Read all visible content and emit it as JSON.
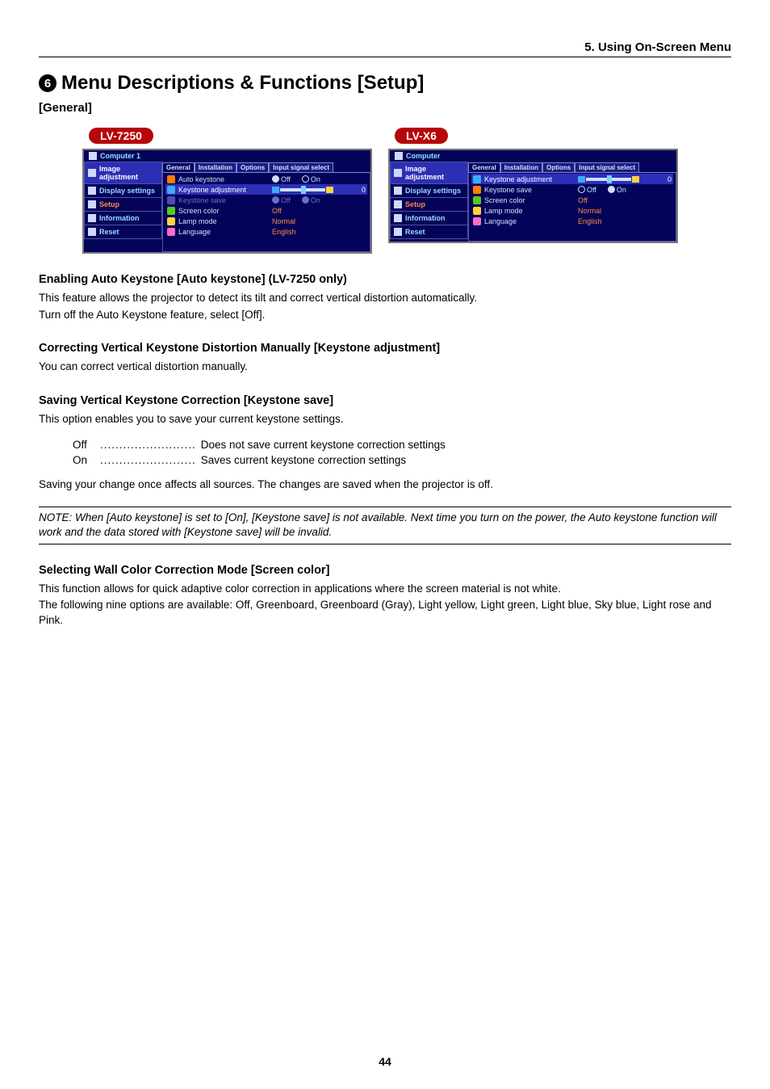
{
  "header": "5. Using On-Screen Menu",
  "bullet_number": "6",
  "main_title": "Menu Descriptions & Functions [Setup]",
  "subsection": "[General]",
  "models": {
    "left": "LV-7250",
    "right": "LV-X6"
  },
  "osd_left": {
    "top": "Computer 1",
    "side": [
      "Image adjustment",
      "Display settings",
      "Setup",
      "Information",
      "Reset"
    ],
    "tabs": [
      "General",
      "Installation",
      "Options",
      "Input signal select"
    ],
    "rows": {
      "auto_keystone": {
        "label": "Auto keystone",
        "off": "Off",
        "on": "On"
      },
      "keystone_adj": {
        "label": "Keystone adjustment",
        "val": "0"
      },
      "keystone_save": {
        "label": "Keystone save",
        "off": "Off",
        "on": "On"
      },
      "screen_color": {
        "label": "Screen color",
        "val": "Off"
      },
      "lamp_mode": {
        "label": "Lamp mode",
        "val": "Normal"
      },
      "language": {
        "label": "Language",
        "val": "English"
      }
    }
  },
  "osd_right": {
    "top": "Computer",
    "side": [
      "Image adjustment",
      "Display settings",
      "Setup",
      "Information",
      "Reset"
    ],
    "tabs": [
      "General",
      "Installation",
      "Options",
      "Input signal select"
    ],
    "rows": {
      "keystone_adj": {
        "label": "Keystone adjustment",
        "val": "0"
      },
      "keystone_save": {
        "label": "Keystone save",
        "off": "Off",
        "on": "On"
      },
      "screen_color": {
        "label": "Screen color",
        "val": "Off"
      },
      "lamp_mode": {
        "label": "Lamp mode",
        "val": "Normal"
      },
      "language": {
        "label": "Language",
        "val": "English"
      }
    }
  },
  "sections": {
    "s1": {
      "h": "Enabling Auto Keystone [Auto keystone] (LV-7250 only)",
      "p1": "This feature allows the projector to detect its tilt and correct vertical distortion automatically.",
      "p2": "Turn off the Auto Keystone feature, select [Off]."
    },
    "s2": {
      "h": "Correcting Vertical Keystone Distortion Manually [Keystone adjustment]",
      "p1": "You can correct vertical distortion manually."
    },
    "s3": {
      "h": "Saving Vertical Keystone Correction [Keystone save]",
      "p1": "This option enables you to save your current keystone settings.",
      "off": {
        "k": "Off",
        "dots": ".........................",
        "v": "Does not save current keystone correction settings"
      },
      "on": {
        "k": "On",
        "dots": ".........................",
        "v": "Saves current keystone correction settings"
      },
      "p2": "Saving your change once affects all sources. The changes are saved when the projector is off.",
      "note": "NOTE: When [Auto keystone] is set to [On], [Keystone save] is not available. Next time you turn on the power, the Auto keystone function will work and the data stored with [Keystone save] will be invalid."
    },
    "s4": {
      "h": "Selecting Wall Color Correction Mode [Screen color]",
      "p1": "This function allows for quick adaptive color correction in applications where the screen material is not white.",
      "p2": "The following nine options are available: Off, Greenboard, Greenboard (Gray), Light yellow, Light green, Light blue, Sky blue, Light rose and Pink."
    }
  },
  "page_number": "44"
}
